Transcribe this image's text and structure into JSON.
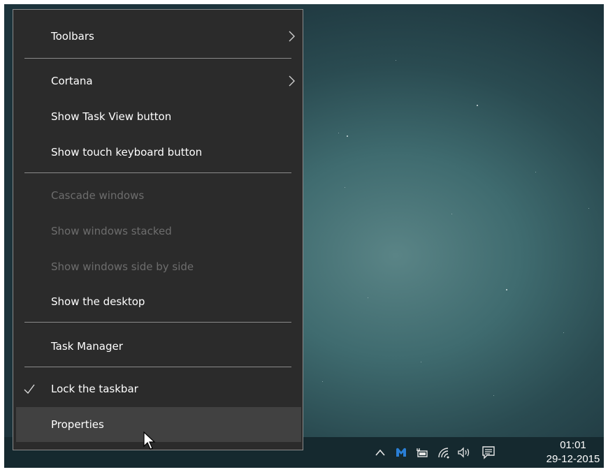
{
  "context_menu": {
    "toolbars": "Toolbars",
    "cortana": "Cortana",
    "show_task_view": "Show Task View button",
    "show_touch_keyboard": "Show touch keyboard button",
    "cascade": "Cascade windows",
    "stacked": "Show windows stacked",
    "side_by_side": "Show windows side by side",
    "show_desktop": "Show the desktop",
    "task_manager": "Task Manager",
    "lock_taskbar": "Lock the taskbar",
    "properties": "Properties"
  },
  "menu_state": {
    "disabled_items": [
      "Cascade windows",
      "Show windows stacked",
      "Show windows side by side"
    ],
    "checked_items": [
      "Lock the taskbar"
    ],
    "hovered_item": "Properties",
    "submenu_items": [
      "Toolbars",
      "Cortana"
    ]
  },
  "taskbar": {
    "time": "01:01",
    "date": "29-12-2015",
    "tray_icons": [
      "chevron-up-icon",
      "malwarebytes-icon",
      "battery-icon",
      "wifi-icon",
      "volume-icon",
      "action-center-icon"
    ]
  },
  "colors": {
    "menu_bg": "#2b2b2b",
    "menu_hover": "#414141",
    "menu_disabled_text": "#6d6d6d",
    "taskbar_bg": "#15292f",
    "accent_icon": "#2a7fd6"
  }
}
